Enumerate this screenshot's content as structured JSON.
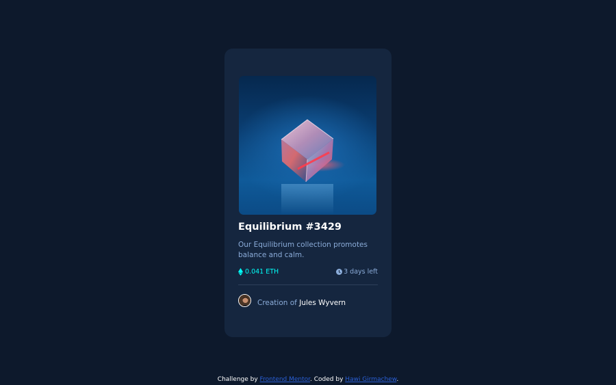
{
  "card": {
    "image_alt": "Equilibrium cube",
    "title": "Equilibrium #3429",
    "description": "Our Equilibrium collection promotes balance and calm.",
    "price": "0.041 ETH",
    "price_icon": "ethereum-icon",
    "time_left": "3 days left",
    "time_icon": "clock-icon",
    "creator_prefix": "Creation of ",
    "creator_name": "Jules Wyvern"
  },
  "attribution": {
    "prefix": "Challenge by ",
    "link1": "Frontend Mentor",
    "middle": ". Coded by ",
    "link2": "Hawi Girmachew",
    "suffix": "."
  },
  "colors": {
    "background": "#0d192c",
    "card": "#15263f",
    "cyan": "#00fff8",
    "soft_blue": "#8bacd9",
    "white": "#ffffff"
  }
}
